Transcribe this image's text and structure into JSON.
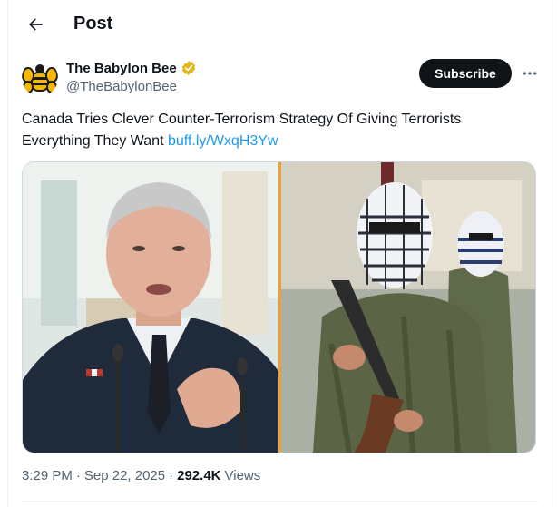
{
  "header": {
    "title": "Post",
    "back_icon": "arrow-left-icon"
  },
  "author": {
    "display_name": "The Babylon Bee",
    "handle": "@TheBabylonBee",
    "verified_color": "#e2b719",
    "avatar_icon": "bee-logo-icon"
  },
  "actions": {
    "subscribe_label": "Subscribe",
    "more_icon": "more-horizontal-icon"
  },
  "tweet": {
    "text": "Canada Tries Clever Counter-Terrorism Strategy Of Giving Terrorists Everything They Want",
    "link": "buff.ly/WxqH3Yw",
    "link_color": "#1d9bf0"
  },
  "media": {
    "left_image": "man-in-suit-speaking-photo",
    "right_image": "masked-militants-photo",
    "divider_color": "#f0a030"
  },
  "meta": {
    "time": "3:29 PM",
    "date": "Sep 22, 2025",
    "views_count": "292.4K",
    "views_label": "Views"
  },
  "colors": {
    "primary_text": "#0f1419",
    "secondary_text": "#536471",
    "border": "#eff3f4"
  }
}
